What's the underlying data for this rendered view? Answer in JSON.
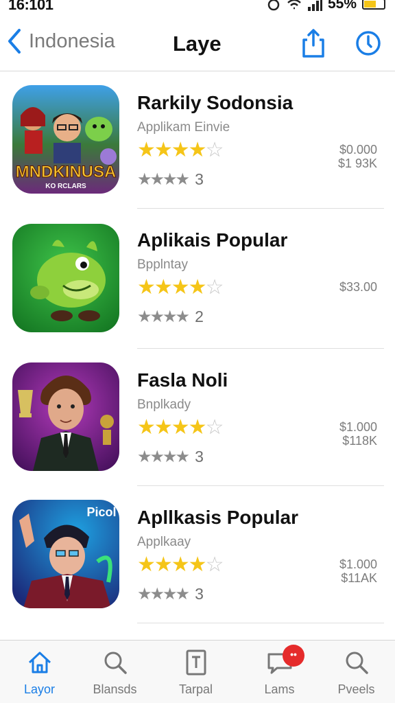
{
  "status_bar": {
    "time": "16:101",
    "battery_percent": "55%"
  },
  "nav": {
    "back_label": "Indonesia",
    "title": "Laye"
  },
  "apps": [
    {
      "name": "Rarkily Sodonsia",
      "subtitle": "Applikam Einvie",
      "rating": 4,
      "stars_text": "★★★★",
      "review_count": "3",
      "price_line1": "$0.000",
      "price_line2": "$1 93K",
      "icon_text_line1": "MNDKINUSA",
      "icon_text_line2": "KO RCLARS"
    },
    {
      "name": "Aplikais Popular",
      "subtitle": "Bpplntay",
      "rating": 4,
      "stars_text": "★★★★",
      "review_count": "2",
      "price_line1": "$33.00",
      "price_line2": ""
    },
    {
      "name": "Fasla Noli",
      "subtitle": "Bnplkady",
      "rating": 4,
      "stars_text": "★★★★",
      "review_count": "3",
      "price_line1": "$1.000",
      "price_line2": "$118K"
    },
    {
      "name": "Apllkasis Popular",
      "subtitle": "Applkaay",
      "rating": 4,
      "stars_text": "★★★★",
      "review_count": "3",
      "price_line1": "$1.000",
      "price_line2": "$11AK",
      "icon_text_line1": "Picol"
    }
  ],
  "tabs": [
    {
      "label": "Layor",
      "icon": "home-icon",
      "active": true
    },
    {
      "label": "Blansds",
      "icon": "search-icon"
    },
    {
      "label": "Tarpal",
      "icon": "document-icon"
    },
    {
      "label": "Lams",
      "icon": "chat-icon",
      "badge": "••"
    },
    {
      "label": "Pveels",
      "icon": "search-icon"
    }
  ],
  "colors": {
    "accent": "#1a7ee6",
    "star": "#f5c518",
    "badge": "#e52b2b"
  }
}
